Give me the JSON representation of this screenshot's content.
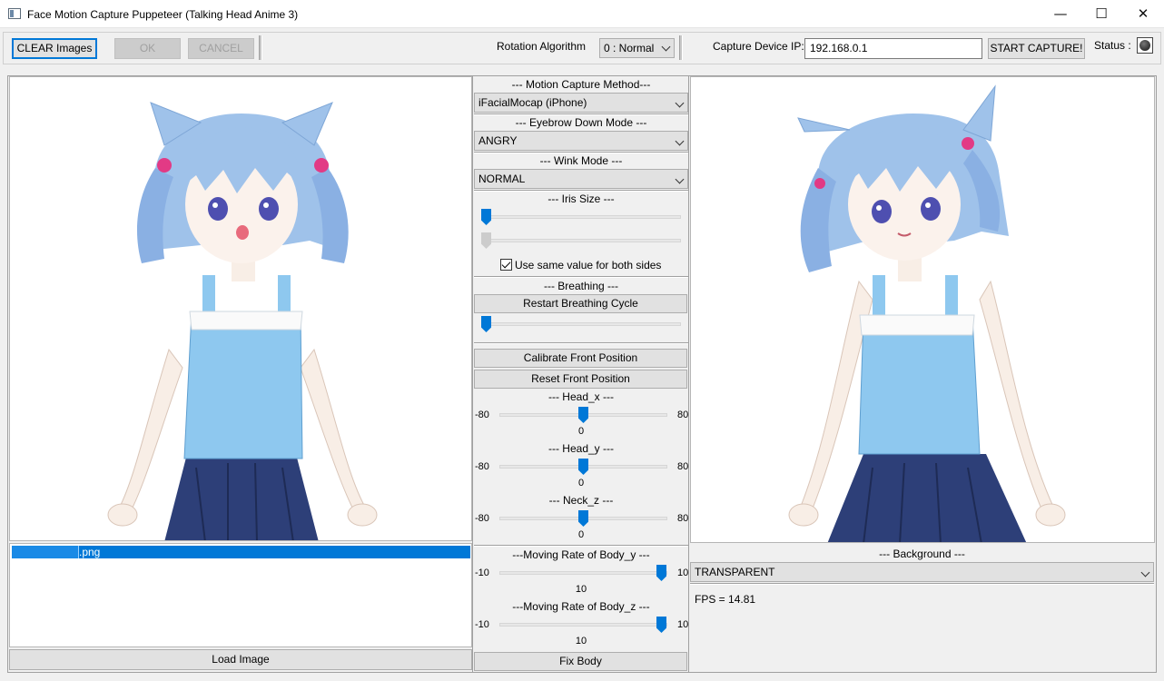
{
  "window": {
    "title": "Face Motion Capture Puppeteer (Talking Head Anime 3)",
    "minimize_glyph": "—",
    "maximize_glyph": "☐",
    "close_glyph": "✕"
  },
  "toolbar": {
    "clear_images": "CLEAR Images",
    "ok": "OK",
    "cancel": "CANCEL",
    "rotation_label": "Rotation Algorithm",
    "rotation_value": "0 : Normal",
    "ip_label": "Capture Device IP:",
    "ip_value": "192.168.0.1",
    "start_capture": "START CAPTURE!",
    "status_label": "Status :"
  },
  "left": {
    "selected_file": ".png",
    "load_image": "Load Image"
  },
  "controls": {
    "motion_title": "--- Motion Capture Method---",
    "motion_value": "iFacialMocap (iPhone)",
    "eyebrow_title": "--- Eyebrow Down Mode ---",
    "eyebrow_value": "ANGRY",
    "wink_title": "--- Wink Mode ---",
    "wink_value": "NORMAL",
    "iris_title": "--- Iris Size ---",
    "same_value_label": "Use same value for both sides",
    "breathing_title": "--- Breathing ---",
    "restart_breathing": "Restart Breathing Cycle",
    "calibrate": "Calibrate Front Position",
    "reset_front": "Reset Front Position",
    "head_x": {
      "title": "--- Head_x ---",
      "min": "-80",
      "max": "80",
      "value": "0"
    },
    "head_y": {
      "title": "--- Head_y ---",
      "min": "-80",
      "max": "80",
      "value": "0"
    },
    "neck_z": {
      "title": "--- Neck_z ---",
      "min": "-80",
      "max": "80",
      "value": "0"
    },
    "body_y": {
      "title": "---Moving Rate of Body_y ---",
      "min": "-10",
      "max": "10",
      "value": "10"
    },
    "body_z": {
      "title": "---Moving Rate of Body_z ---",
      "min": "-10",
      "max": "10",
      "value": "10"
    },
    "fix_body": "Fix Body"
  },
  "right": {
    "background_title": "--- Background ---",
    "background_value": "TRANSPARENT",
    "fps": "FPS = 14.81"
  },
  "colors": {
    "accent": "#0078d7",
    "hair": "#9fc2ea",
    "top": "#8ec8ef",
    "skirt": "#2d3f78"
  }
}
